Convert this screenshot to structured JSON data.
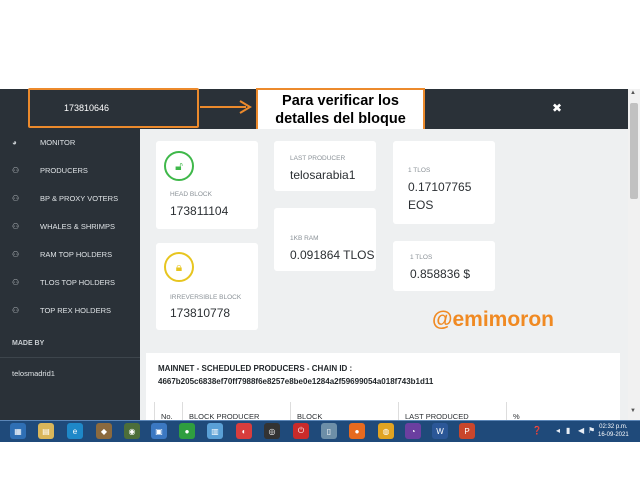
{
  "header": {
    "block_number": "173810646",
    "callout_text": "Para verificar los detalles del bloque",
    "close_symbol": "✖"
  },
  "sidebar": {
    "items": [
      {
        "label": "MONITOR",
        "icon": "gauge-icon"
      },
      {
        "label": "PRODUCERS",
        "icon": "users-icon"
      },
      {
        "label": "BP & PROXY VOTERS",
        "icon": "users-icon"
      },
      {
        "label": "WHALES & SHRIMPS",
        "icon": "users-icon"
      },
      {
        "label": "RAM TOP HOLDERS",
        "icon": "users-icon"
      },
      {
        "label": "TLOS TOP HOLDERS",
        "icon": "users-icon"
      },
      {
        "label": "TOP REX HOLDERS",
        "icon": "users-icon"
      }
    ],
    "made_by_label": "MADE BY",
    "made_by_name": "telosmadrid1"
  },
  "cards": {
    "head_block": {
      "label": "HEAD BLOCK",
      "value": "173811104"
    },
    "irreversible_block": {
      "label": "IRREVERSIBLE BLOCK",
      "value": "173810778"
    },
    "last_producer": {
      "label": "LAST PRODUCER",
      "value": "telosarabia1"
    },
    "ram": {
      "label": "1KB RAM",
      "value": "0.091864 TLOS"
    },
    "tlos_eos": {
      "label": "1 TLOS",
      "value_line1": "0.17107765",
      "value_line2": "EOS"
    },
    "tlos_usd": {
      "label": "1 TLOS",
      "value": "0.858836 $"
    }
  },
  "watermark": "@emimoron",
  "schedule": {
    "title": "MAINNET - SCHEDULED PRODUCERS - CHAIN ID :",
    "chain_id": "4667b205c6838ef70ff7988f6e8257e8be0e1284a2f59699054a018f743b1d11",
    "columns": [
      "No.",
      "BLOCK PRODUCER",
      "BLOCK",
      "LAST PRODUCED",
      "%"
    ]
  },
  "taskbar": {
    "time": "02:32 p.m.",
    "date": "16-09-2021"
  },
  "colors": {
    "sidebar_bg": "#2a3138",
    "highlight_orange": "#ec8a2c",
    "head_lock_green": "#3fb84a",
    "irreversible_lock_yellow": "#e7c51f",
    "taskbar_blue": "#1f4a7a"
  }
}
